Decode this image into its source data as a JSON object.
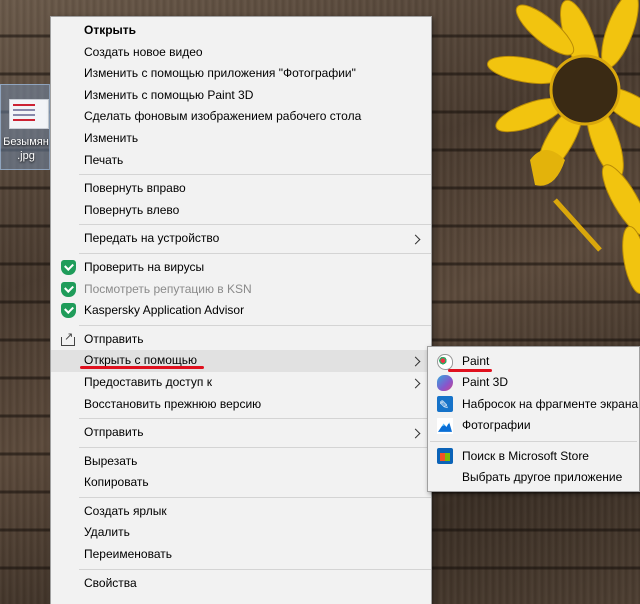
{
  "desktop_file": {
    "name_line1": "Безымян",
    "name_line2": ".jpg"
  },
  "context_menu": {
    "group1": [
      {
        "label": "Открыть",
        "bold": true
      },
      {
        "label": "Создать новое видео"
      },
      {
        "label": "Изменить с помощью приложения \"Фотографии\""
      },
      {
        "label": "Изменить с помощью Paint 3D"
      },
      {
        "label": "Сделать фоновым изображением рабочего стола"
      },
      {
        "label": "Изменить"
      },
      {
        "label": "Печать"
      }
    ],
    "group2": [
      {
        "label": "Повернуть вправо"
      },
      {
        "label": "Повернуть влево"
      }
    ],
    "group3": [
      {
        "label": "Передать на устройство",
        "submenu": true
      }
    ],
    "group4": [
      {
        "label": "Проверить на вирусы",
        "icon": "kaspersky-shield-icon"
      },
      {
        "label": "Посмотреть репутацию в KSN",
        "icon": "kaspersky-shield-icon",
        "disabled": true
      },
      {
        "label": "Kaspersky Application Advisor",
        "icon": "kaspersky-shield-icon"
      }
    ],
    "group5": [
      {
        "label": "Отправить",
        "icon": "share-icon"
      },
      {
        "label": "Открыть с помощью",
        "submenu": true,
        "highlighted": true
      },
      {
        "label": "Предоставить доступ к",
        "submenu": true
      },
      {
        "label": "Восстановить прежнюю версию"
      }
    ],
    "group6": [
      {
        "label": "Отправить",
        "submenu": true
      }
    ],
    "group7": [
      {
        "label": "Вырезать"
      },
      {
        "label": "Копировать"
      }
    ],
    "group8": [
      {
        "label": "Создать ярлык"
      },
      {
        "label": "Удалить"
      },
      {
        "label": "Переименовать"
      }
    ],
    "group9": [
      {
        "label": "Свойства"
      }
    ]
  },
  "open_with_submenu": {
    "apps": [
      {
        "label": "Paint",
        "icon": "paint-icon"
      },
      {
        "label": "Paint 3D",
        "icon": "paint3d-icon"
      },
      {
        "label": "Набросок на фрагменте экрана",
        "icon": "snip-sketch-icon"
      },
      {
        "label": "Фотографии",
        "icon": "photos-icon"
      }
    ],
    "extra": [
      {
        "label": "Поиск в Microsoft Store",
        "icon": "store-icon"
      },
      {
        "label": "Выбрать другое приложение"
      }
    ]
  },
  "annotation_color": "#e0101e"
}
